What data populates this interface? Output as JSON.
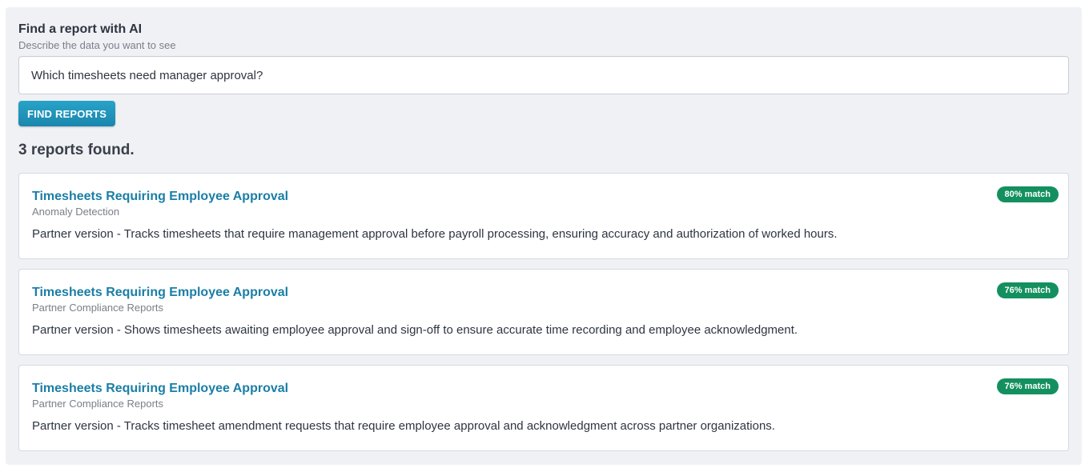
{
  "finder": {
    "title": "Find a report with AI",
    "subtitle": "Describe the data you want to see",
    "query": "Which timesheets need manager approval?",
    "button_label": "FIND REPORTS"
  },
  "results": {
    "count_text": "3 reports found.",
    "items": [
      {
        "title": "Timesheets Requiring Employee Approval",
        "category": "Anomaly Detection",
        "description": "Partner version - Tracks timesheets that require management approval before payroll processing, ensuring accuracy and authorization of worked hours.",
        "match": "80% match"
      },
      {
        "title": "Timesheets Requiring Employee Approval",
        "category": "Partner Compliance Reports",
        "description": "Partner version - Shows timesheets awaiting employee approval and sign-off to ensure accurate time recording and employee acknowledgment.",
        "match": "76% match"
      },
      {
        "title": "Timesheets Requiring Employee Approval",
        "category": "Partner Compliance Reports",
        "description": "Partner version - Tracks timesheet amendment requests that require employee approval and acknowledgment across partner organizations.",
        "match": "76% match"
      }
    ]
  },
  "colors": {
    "accent": "#1a7ea6",
    "button": "#1b86ad",
    "match_badge": "#14905f",
    "panel_bg": "#f0f1f5"
  }
}
